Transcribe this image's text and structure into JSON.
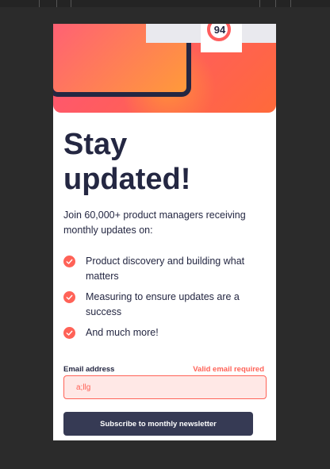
{
  "page": {
    "hero": {
      "score": "94"
    },
    "title_line1": "Stay",
    "title_line2": "updated!",
    "intro": "Join 60,000+ product managers receiving monthly updates on:",
    "features": [
      {
        "text": "Product discovery and building what matters",
        "icon": "check-circle-icon"
      },
      {
        "text": "Measuring to ensure updates are a success",
        "icon": "check-circle-icon"
      },
      {
        "text": "And much more!",
        "icon": "check-circle-icon"
      }
    ],
    "form": {
      "email_label": "Email address",
      "error_text": "Valid email required",
      "email_value": "a;llg",
      "submit_label": "Subscribe to monthly newsletter"
    }
  },
  "colors": {
    "dark_navy": "#242742",
    "tomato": "#ff6257",
    "button_bg": "#363a54",
    "error_bg": "#ffe8e6"
  }
}
